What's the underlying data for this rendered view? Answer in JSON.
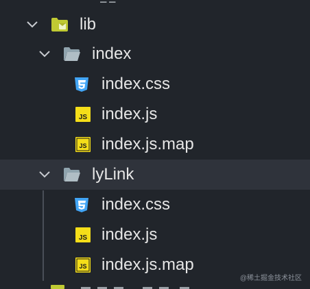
{
  "tree": {
    "lib": {
      "label": "lib"
    },
    "index_folder": {
      "label": "index",
      "files": [
        {
          "name": "index.css",
          "icon": "css3-icon"
        },
        {
          "name": "index.js",
          "icon": "javascript-icon"
        },
        {
          "name": "index.js.map",
          "icon": "javascript-map-icon"
        }
      ]
    },
    "lylink_folder": {
      "label": "lyLink",
      "files": [
        {
          "name": "index.css",
          "icon": "css3-icon"
        },
        {
          "name": "index.js",
          "icon": "javascript-icon"
        },
        {
          "name": "index.js.map",
          "icon": "javascript-map-icon"
        }
      ]
    }
  },
  "icon_text": {
    "js": "JS"
  },
  "colors": {
    "background": "#21252b",
    "selected_row": "#2f333b",
    "text": "#e6e6e6",
    "css_icon": "#42a5f5",
    "js_icon": "#f5de19",
    "lib_folder": "#c0ca33",
    "folder": "#90a4ae"
  },
  "watermark": "@稀土掘金技术社区"
}
